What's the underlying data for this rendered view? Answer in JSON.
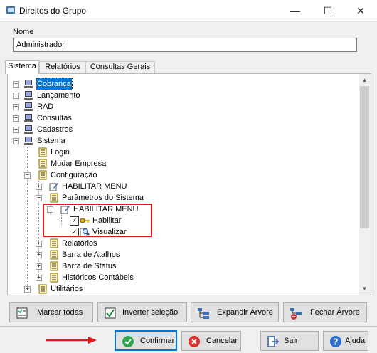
{
  "window": {
    "title": "Direitos do Grupo"
  },
  "form": {
    "nome_label": "Nome",
    "nome_value": "Administrador"
  },
  "tabs": [
    "Sistema",
    "Relatórios",
    "Consultas Gerais"
  ],
  "tree": {
    "items": [
      "Cobrança",
      "Lançamento",
      "RAD",
      "Consultas",
      "Cadastros",
      "Sistema",
      "Login",
      "Mudar Empresa",
      "Configuração",
      "HABILITAR MENU",
      "Parâmetros do Sistema",
      "HABILITAR MENU",
      "Habilitar",
      "Visualizar",
      "Relatórios",
      "Barra de Atalhos",
      "Barra de Status",
      "Históricos Contábeis",
      "Utilitários"
    ]
  },
  "actions": {
    "marcar": "Marcar todas",
    "inverter": "Inverter seleção",
    "expandir": "Expandir Árvore",
    "fechar": "Fechar Árvore"
  },
  "footer": {
    "confirmar": "Confirmar",
    "cancelar": "Cancelar",
    "sair": "Sair",
    "ajuda": "Ajuda"
  },
  "colors": {
    "highlight": "#0078d7",
    "annotation": "#e0191d"
  }
}
